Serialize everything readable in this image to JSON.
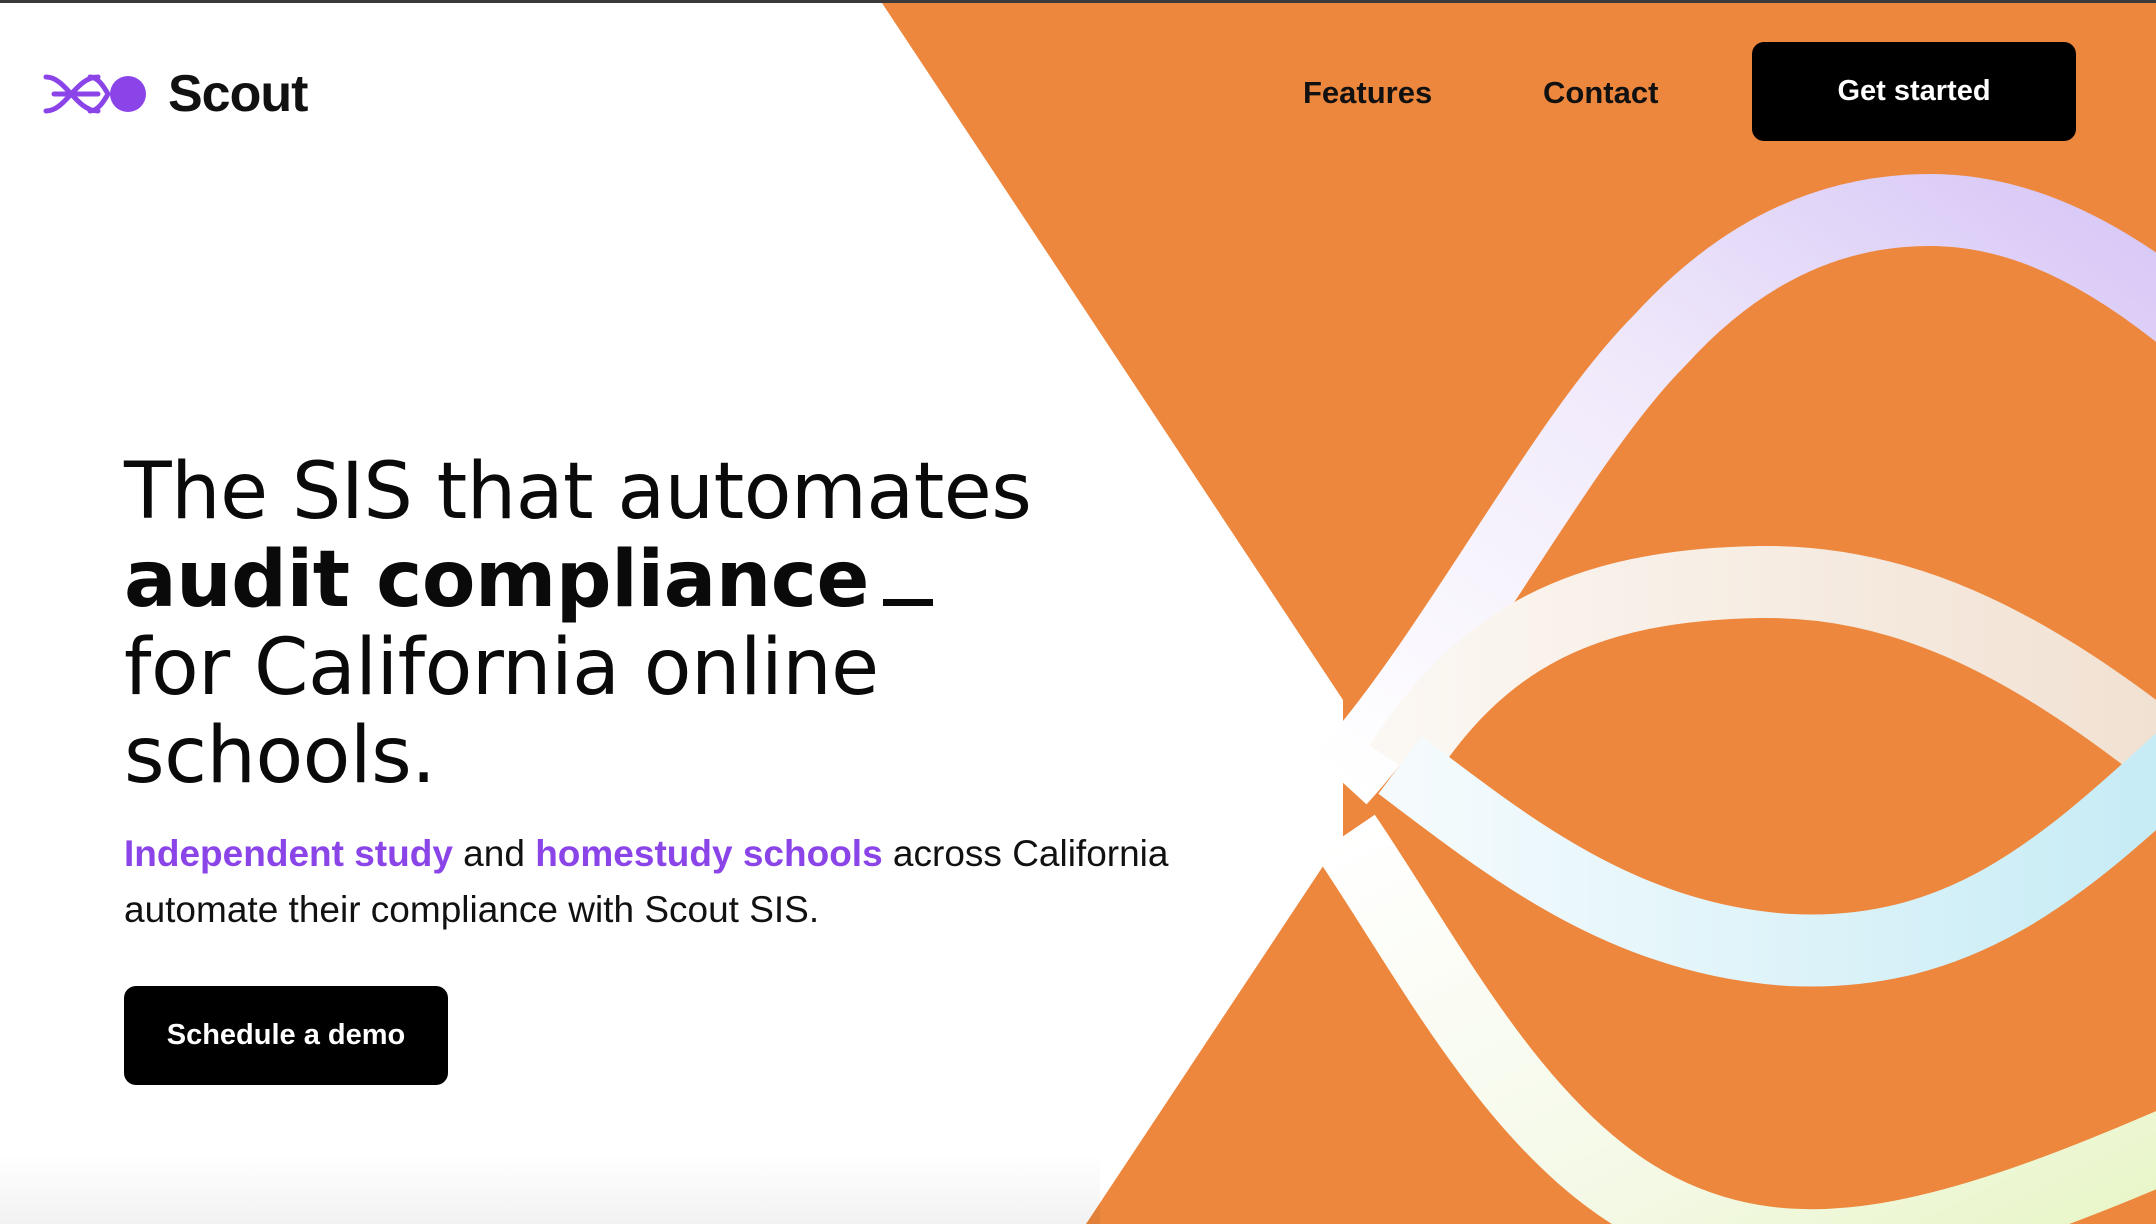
{
  "brand": {
    "name": "Scout",
    "logo_icon": "scout-logo-icon",
    "logo_color": "#8a44e8"
  },
  "nav": {
    "features_label": "Features",
    "contact_label": "Contact",
    "cta_label": "Get started"
  },
  "hero": {
    "title_line1": "The SIS that automates",
    "title_line2": "audit compliance",
    "title_line3": "for California online",
    "title_line4": "schools.",
    "sub_link1": "Independent study",
    "sub_text1": " and ",
    "sub_link2": "homestudy schools",
    "sub_text2": " across California automate their compliance with Scout SIS.",
    "cta_label": "Schedule a demo"
  },
  "colors": {
    "accent": "#8a44e8",
    "background_orange": "#ed873d",
    "button": "#000000",
    "button_text": "#ffffff"
  }
}
